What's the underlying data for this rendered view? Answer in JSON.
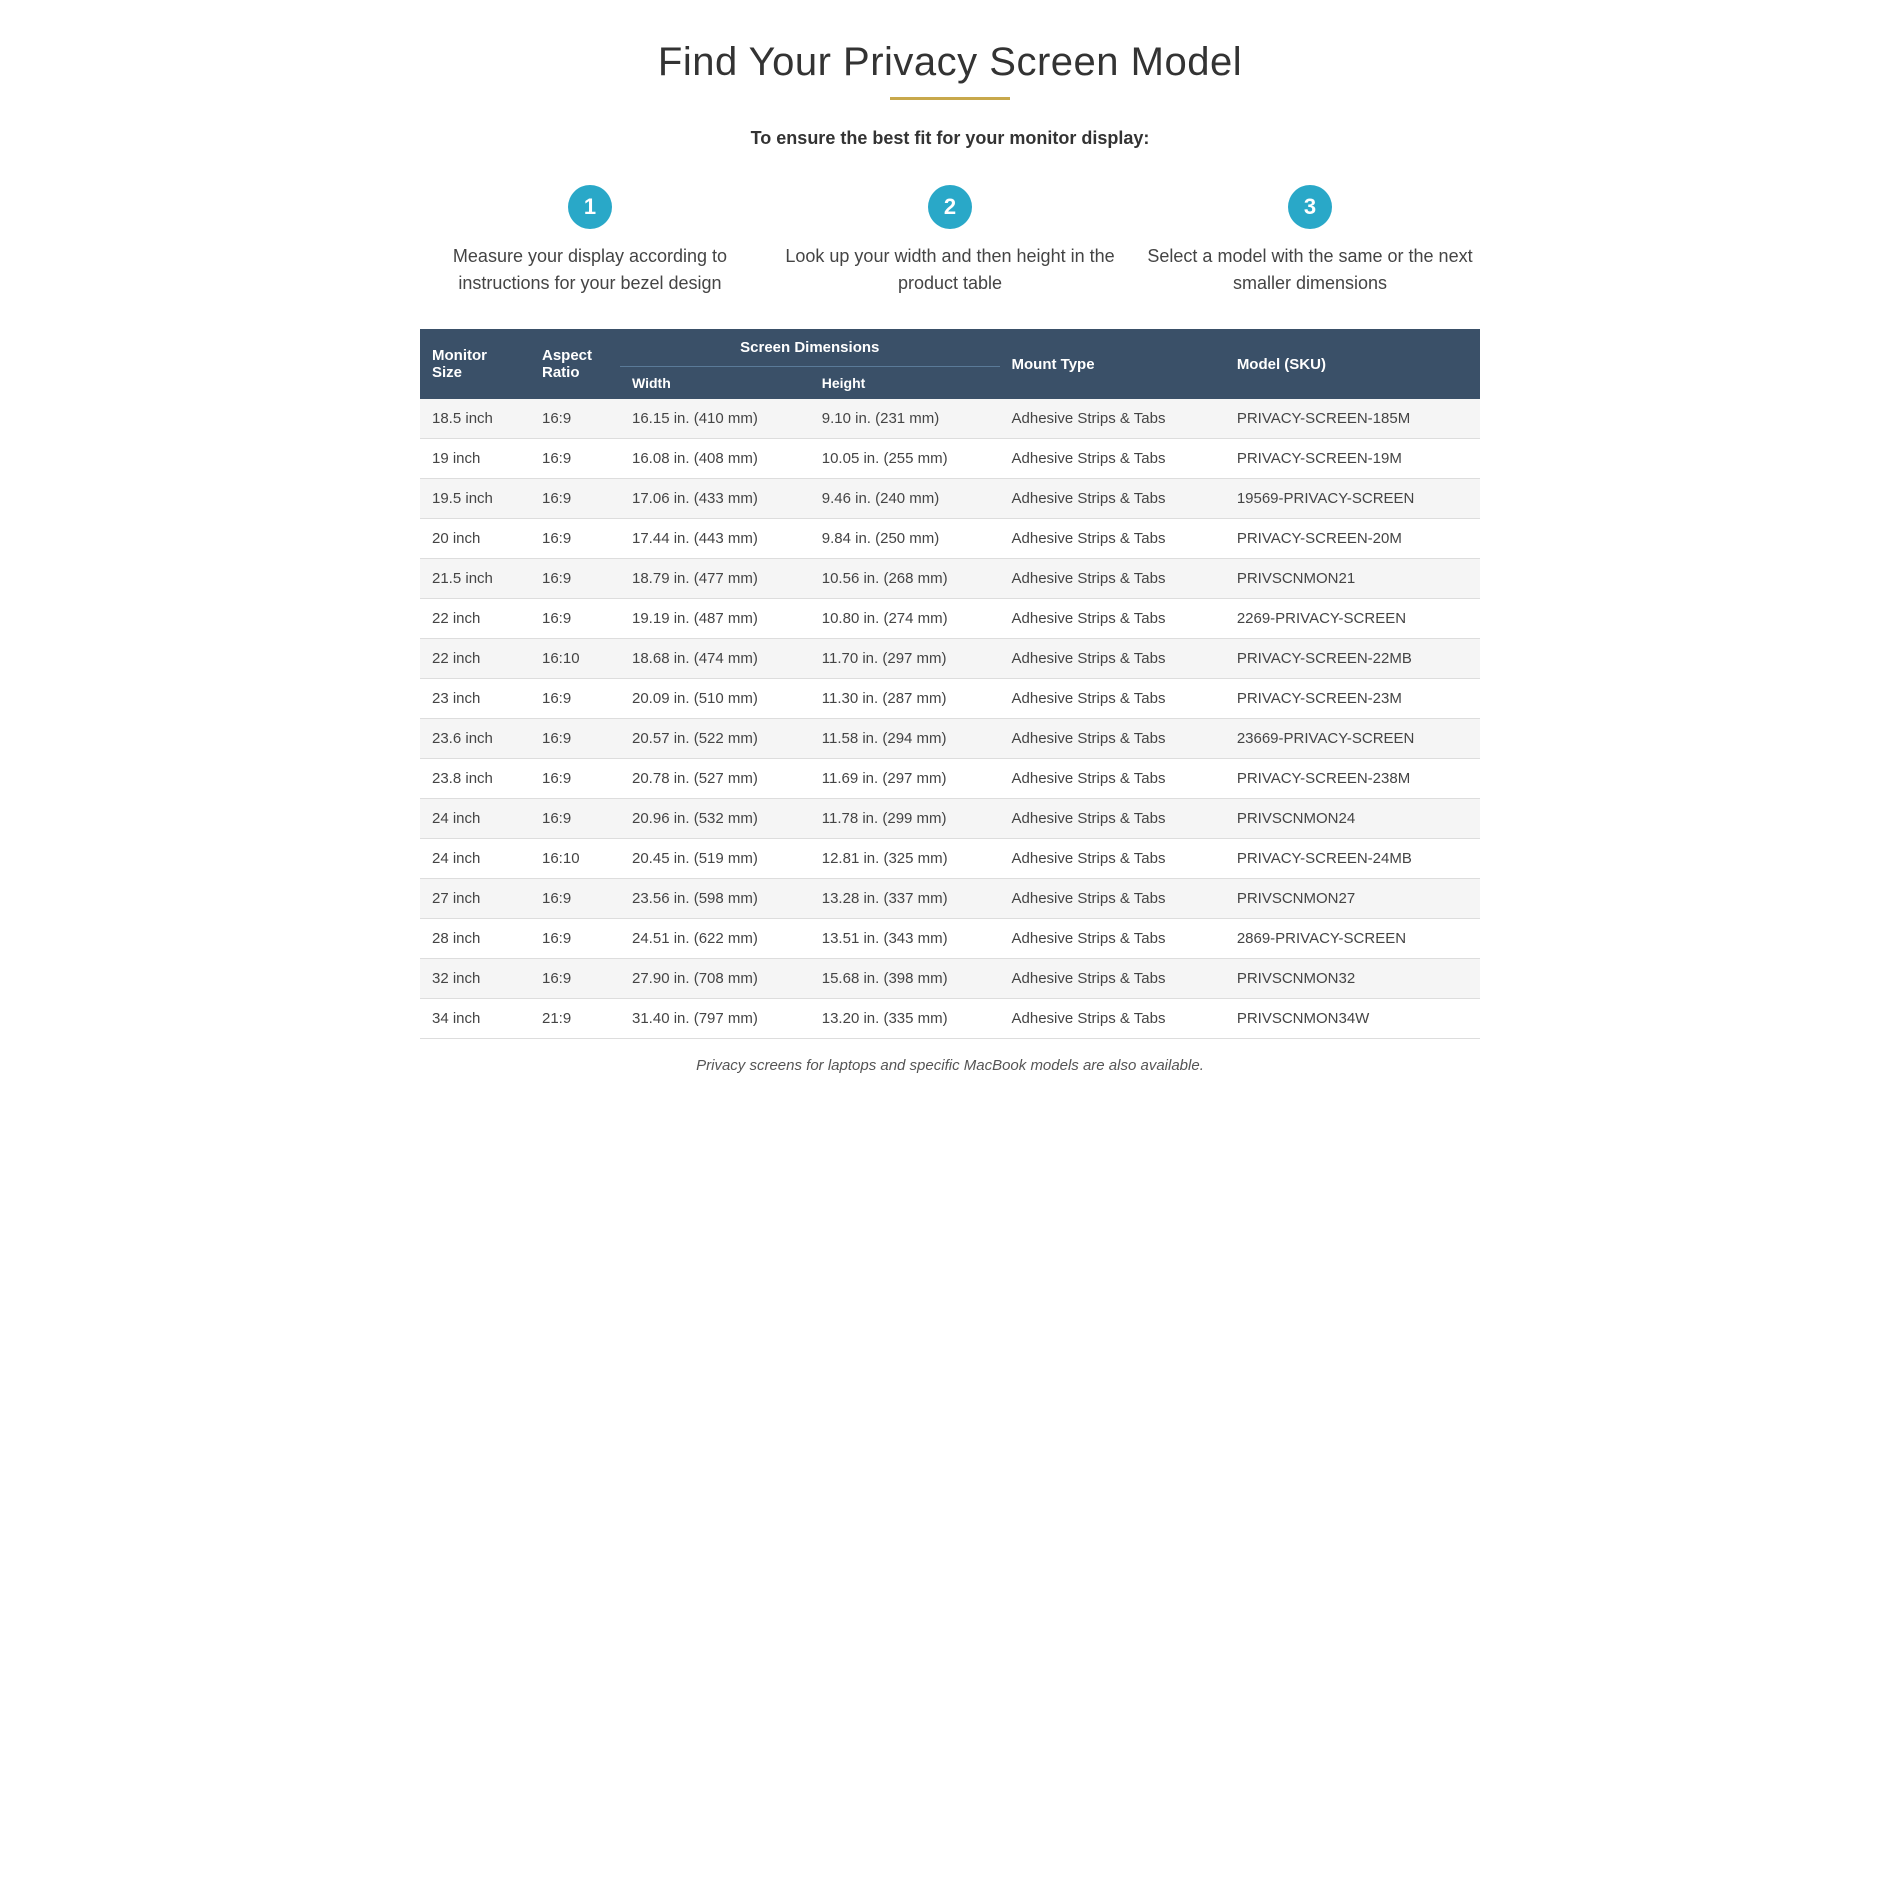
{
  "title": "Find Your Privacy Screen Model",
  "divider": true,
  "subtitle": "To ensure the best fit for your monitor display:",
  "steps": [
    {
      "number": "1",
      "text": "Measure your display according to instructions for your bezel design"
    },
    {
      "number": "2",
      "text": "Look up your width and then height in the product table"
    },
    {
      "number": "3",
      "text": "Select a model with the same or the next smaller dimensions"
    }
  ],
  "table": {
    "col_headers": {
      "monitor_size": "Monitor Size",
      "aspect_ratio": "Aspect Ratio",
      "screen_dimensions": "Screen Dimensions",
      "width": "Width",
      "height": "Height",
      "mount_type": "Mount Type",
      "model_sku": "Model (SKU)"
    },
    "rows": [
      {
        "size": "18.5 inch",
        "aspect": "16:9",
        "width": "16.15 in. (410 mm)",
        "height": "9.10 in. (231 mm)",
        "mount": "Adhesive Strips & Tabs",
        "model": "PRIVACY-SCREEN-185M"
      },
      {
        "size": "19 inch",
        "aspect": "16:9",
        "width": "16.08 in. (408 mm)",
        "height": "10.05 in. (255 mm)",
        "mount": "Adhesive Strips & Tabs",
        "model": "PRIVACY-SCREEN-19M"
      },
      {
        "size": "19.5 inch",
        "aspect": "16:9",
        "width": "17.06 in. (433 mm)",
        "height": "9.46 in. (240 mm)",
        "mount": "Adhesive Strips & Tabs",
        "model": "19569-PRIVACY-SCREEN"
      },
      {
        "size": "20 inch",
        "aspect": "16:9",
        "width": "17.44 in. (443 mm)",
        "height": "9.84 in. (250 mm)",
        "mount": "Adhesive Strips & Tabs",
        "model": "PRIVACY-SCREEN-20M"
      },
      {
        "size": "21.5 inch",
        "aspect": "16:9",
        "width": "18.79 in. (477 mm)",
        "height": "10.56 in. (268 mm)",
        "mount": "Adhesive Strips & Tabs",
        "model": "PRIVSCNMON21"
      },
      {
        "size": "22 inch",
        "aspect": "16:9",
        "width": "19.19 in. (487 mm)",
        "height": "10.80 in. (274 mm)",
        "mount": "Adhesive Strips & Tabs",
        "model": "2269-PRIVACY-SCREEN"
      },
      {
        "size": "22 inch",
        "aspect": "16:10",
        "width": "18.68 in. (474 mm)",
        "height": "11.70 in. (297 mm)",
        "mount": "Adhesive Strips & Tabs",
        "model": "PRIVACY-SCREEN-22MB"
      },
      {
        "size": "23 inch",
        "aspect": "16:9",
        "width": "20.09 in. (510 mm)",
        "height": "11.30 in. (287 mm)",
        "mount": "Adhesive Strips & Tabs",
        "model": "PRIVACY-SCREEN-23M"
      },
      {
        "size": "23.6 inch",
        "aspect": "16:9",
        "width": "20.57 in. (522 mm)",
        "height": "11.58 in. (294 mm)",
        "mount": "Adhesive Strips & Tabs",
        "model": "23669-PRIVACY-SCREEN"
      },
      {
        "size": "23.8 inch",
        "aspect": "16:9",
        "width": "20.78 in. (527 mm)",
        "height": "11.69 in. (297 mm)",
        "mount": "Adhesive Strips & Tabs",
        "model": "PRIVACY-SCREEN-238M"
      },
      {
        "size": "24 inch",
        "aspect": "16:9",
        "width": "20.96 in. (532 mm)",
        "height": "11.78 in. (299 mm)",
        "mount": "Adhesive Strips & Tabs",
        "model": "PRIVSCNMON24"
      },
      {
        "size": "24 inch",
        "aspect": "16:10",
        "width": "20.45 in. (519 mm)",
        "height": "12.81 in. (325 mm)",
        "mount": "Adhesive Strips & Tabs",
        "model": "PRIVACY-SCREEN-24MB"
      },
      {
        "size": "27 inch",
        "aspect": "16:9",
        "width": "23.56 in. (598 mm)",
        "height": "13.28 in. (337 mm)",
        "mount": "Adhesive Strips & Tabs",
        "model": "PRIVSCNMON27"
      },
      {
        "size": "28 inch",
        "aspect": "16:9",
        "width": "24.51 in. (622 mm)",
        "height": "13.51 in. (343 mm)",
        "mount": "Adhesive Strips & Tabs",
        "model": "2869-PRIVACY-SCREEN"
      },
      {
        "size": "32 inch",
        "aspect": "16:9",
        "width": "27.90 in. (708 mm)",
        "height": "15.68 in. (398 mm)",
        "mount": "Adhesive Strips & Tabs",
        "model": "PRIVSCNMON32"
      },
      {
        "size": "34 inch",
        "aspect": "21:9",
        "width": "31.40 in. (797 mm)",
        "height": "13.20 in. (335 mm)",
        "mount": "Adhesive Strips & Tabs",
        "model": "PRIVSCNMON34W"
      }
    ]
  },
  "footer": "Privacy screens for laptops and specific MacBook models are also available."
}
